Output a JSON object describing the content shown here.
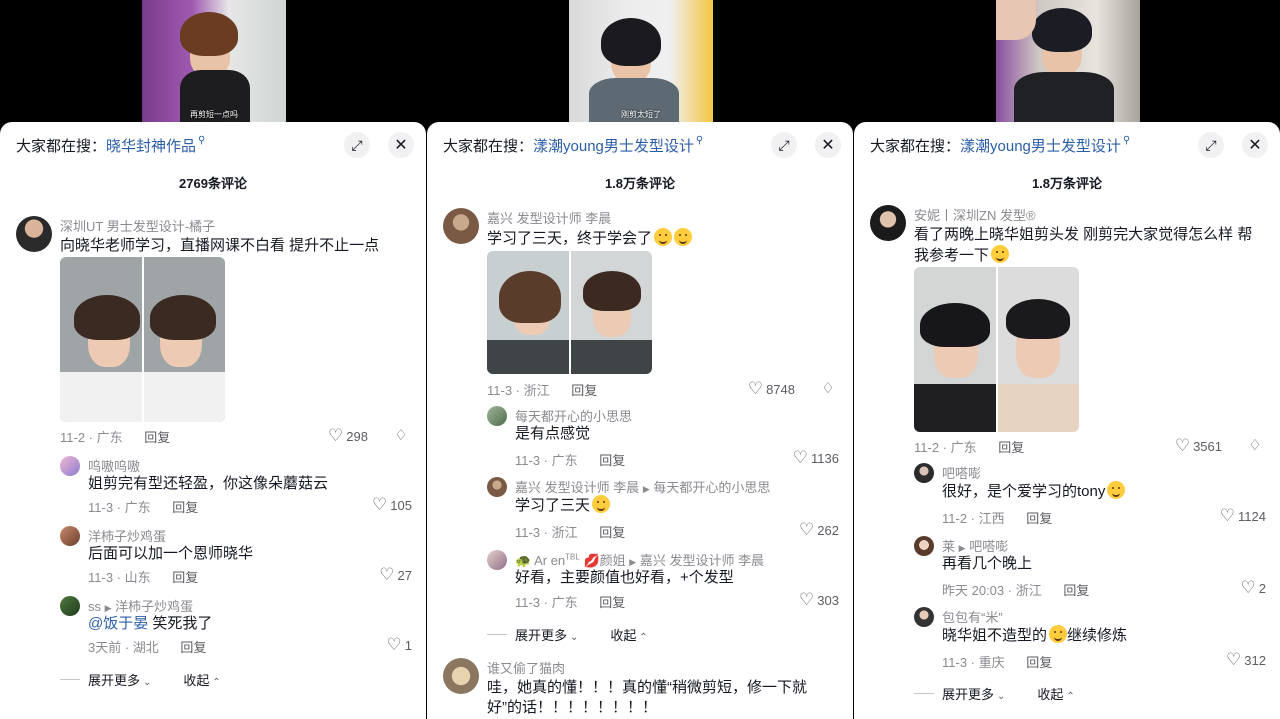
{
  "panels": [
    {
      "video_caption": "再剪短一点吗",
      "search_prefix": "大家都在搜：",
      "search_term": "晓华封神作品",
      "comment_count": "2769条评论",
      "comments": [
        {
          "user": "深圳UT 男士发型设计-橘子",
          "text": "向晓华老师学习，直播网课不白看 提升不止一点",
          "date": "11-2 · 广东",
          "reply": "回复",
          "likes": "298"
        }
      ],
      "replies": [
        {
          "user": "呜嗷呜嗷",
          "text": "姐剪完有型还轻盈，你这像朵蘑菇云",
          "date": "11-3 · 广东",
          "reply": "回复",
          "likes": "105"
        },
        {
          "user": "洋柿子炒鸡蛋",
          "text": "后面可以加一个恩师晓华",
          "date": "11-3 · 山东",
          "reply": "回复",
          "likes": "27"
        },
        {
          "user": "ss",
          "reply_to": "洋柿子炒鸡蛋",
          "text_mention": "@饭于晏",
          "text": " 笑死我了",
          "date": "3天前 · 湖北",
          "reply": "回复",
          "likes": "1"
        }
      ],
      "expand_more": "展开更多",
      "collapse": "收起"
    },
    {
      "video_caption": "刚剪太短了",
      "search_prefix": "大家都在搜：",
      "search_term": "漾潮young男士发型设计",
      "comment_count": "1.8万条评论",
      "comments": [
        {
          "user": "嘉兴 发型设计师 李晨",
          "text": "学习了三天，终于学会了",
          "date": "11-3 · 浙江",
          "reply": "回复",
          "likes": "8748"
        }
      ],
      "replies": [
        {
          "user": "每天都开心的小思思",
          "text": "是有点感觉",
          "date": "11-3 · 广东",
          "reply": "回复",
          "likes": "1136"
        },
        {
          "user": "嘉兴 发型设计师 李晨",
          "reply_to": "每天都开心的小思思",
          "text": "学习了三天",
          "date": "11-3 · 浙江",
          "reply": "回复",
          "likes": "262"
        },
        {
          "user": "Ar en",
          "user_tag": "TBL",
          "user_suffix": "颜姐",
          "reply_to": "嘉兴 发型设计师 李晨",
          "text": "好看，主要颜值也好看，+个发型",
          "date": "11-3 · 广东",
          "reply": "回复",
          "likes": "303"
        }
      ],
      "expand_more": "展开更多",
      "collapse": "收起",
      "next_comment": {
        "user": "谁又偷了猫肉",
        "text": "哇，她真的懂！！！真的懂“稍微剪短，修一下就好”的话！！！！！！！！"
      }
    },
    {
      "search_prefix": "大家都在搜：",
      "search_term": "漾潮young男士发型设计",
      "comment_count": "1.8万条评论",
      "comments": [
        {
          "user": "安妮丨深圳ZN 发型®",
          "text": "看了两晚上晓华姐剪头发 刚剪完大家觉得怎么样 帮我参考一下",
          "date": "11-2 · 广东",
          "reply": "回复",
          "likes": "3561"
        }
      ],
      "replies": [
        {
          "user": "吧嗒嘭",
          "text": "很好，是个爱学习的tony",
          "date": "11-2 · 江西",
          "reply": "回复",
          "likes": "1124"
        },
        {
          "user": "莱",
          "reply_to": "吧嗒嘭",
          "text": "再看几个晚上",
          "date": "昨天 20:03 · 浙江",
          "reply": "回复",
          "likes": "2"
        },
        {
          "user": "包包有“米”",
          "text": "晓华姐不造型的",
          "text_after": "继续修炼",
          "date": "11-3 · 重庆",
          "reply": "回复",
          "likes": "312"
        }
      ],
      "expand_more": "展开更多",
      "collapse": "收起"
    }
  ],
  "icons": {
    "expand": "expand-icon",
    "close": "close-icon",
    "heart": "heart-icon",
    "dislike": "dislike-icon"
  },
  "colors": {
    "link_blue": "#2b5ea7",
    "meta_gray": "#8a8b91",
    "text": "#161823"
  }
}
